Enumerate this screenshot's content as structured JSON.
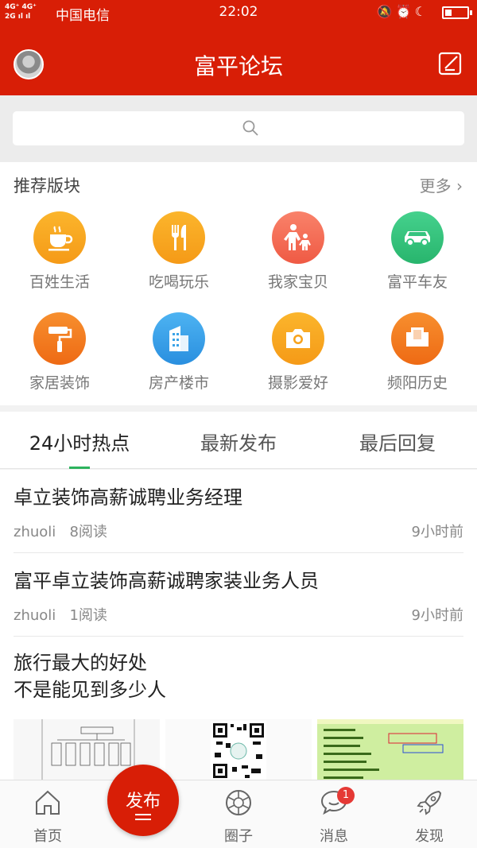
{
  "status_bar": {
    "network": "4G⁺ 4G\n2G",
    "carrier": "中国电信",
    "time": "22:02",
    "indicator_icons": [
      "bell-off-icon",
      "alarm-icon",
      "moon-icon",
      "battery-icon"
    ]
  },
  "header": {
    "title": "富平论坛",
    "avatar_icon": "avatar",
    "compose_icon": "compose-icon"
  },
  "search": {
    "placeholder": ""
  },
  "recommended": {
    "heading": "推荐版块",
    "more": "更多 ›",
    "categories": [
      {
        "label": "百姓生活",
        "icon": "coffee-cup-icon",
        "color": "#f7a21b"
      },
      {
        "label": "吃喝玩乐",
        "icon": "fork-knife-icon",
        "color": "#f7a21b"
      },
      {
        "label": "我家宝贝",
        "icon": "parent-child-icon",
        "color": "#f36b52"
      },
      {
        "label": "富平车友",
        "icon": "car-icon",
        "color": "#35c47f"
      },
      {
        "label": "家居装饰",
        "icon": "paint-roller-icon",
        "color": "#f27a1e"
      },
      {
        "label": "房产楼市",
        "icon": "building-icon",
        "color": "#3aa3e8"
      },
      {
        "label": "摄影爱好",
        "icon": "camera-icon",
        "color": "#f7a21b"
      },
      {
        "label": "频阳历史",
        "icon": "book-icon",
        "color": "#f27a1e"
      }
    ]
  },
  "tabs": [
    {
      "label": "24小时热点",
      "active": true
    },
    {
      "label": "最新发布",
      "active": false
    },
    {
      "label": "最后回复",
      "active": false
    }
  ],
  "accent_color": "#d81e06",
  "tab_indicator_color": "#2db35d",
  "posts": [
    {
      "title": "卓立装饰高薪诚聘业务经理",
      "author": "zhuoli",
      "reads": "8阅读",
      "time": "9小时前"
    },
    {
      "title": "富平卓立装饰高薪诚聘家装业务人员",
      "author": "zhuoli",
      "reads": "1阅读",
      "time": "9小时前"
    },
    {
      "title_line1": "旅行最大的好处",
      "title_line2": "不是能见到多少人"
    }
  ],
  "bottom_nav": {
    "publish": "发布",
    "items": [
      {
        "label": "首页",
        "icon": "home-icon"
      },
      {
        "label": "圈子",
        "icon": "aperture-icon"
      },
      {
        "label": "消息",
        "icon": "chat-bubble-icon",
        "badge": "1"
      },
      {
        "label": "发现",
        "icon": "rocket-icon"
      }
    ]
  }
}
